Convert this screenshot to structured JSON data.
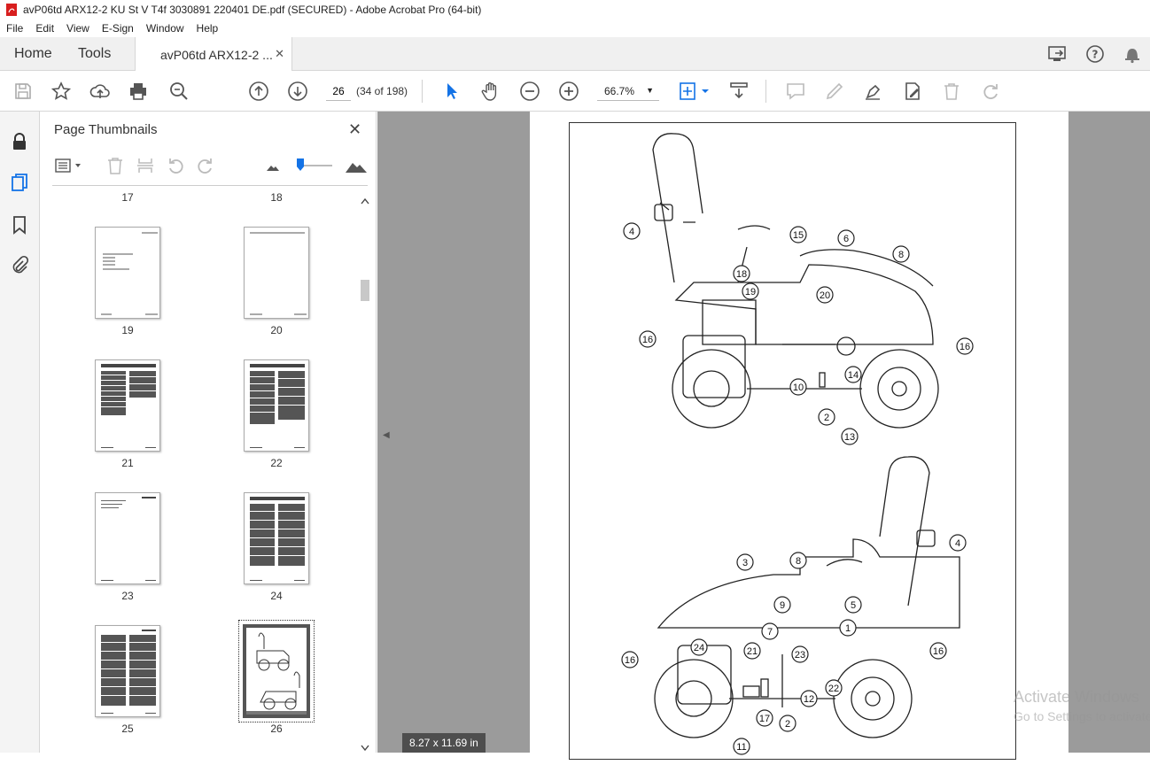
{
  "window": {
    "title": "avP06td ARX12-2 KU St V T4f 3030891 220401 DE.pdf (SECURED) - Adobe Acrobat Pro (64-bit)"
  },
  "menu": [
    "File",
    "Edit",
    "View",
    "E-Sign",
    "Window",
    "Help"
  ],
  "tabs": {
    "home": "Home",
    "tools": "Tools",
    "document": "avP06td ARX12-2 ..."
  },
  "toolbar": {
    "page_current": "26",
    "page_count": "(34 of 198)",
    "zoom": "66.7%"
  },
  "thumbnails": {
    "title": "Page Thumbnails",
    "top_labels": [
      "17",
      "18"
    ],
    "pages": [
      "19",
      "20",
      "21",
      "22",
      "23",
      "24",
      "25",
      "26"
    ],
    "selected_page": "26"
  },
  "document": {
    "page_size": "8.27 x 11.69 in",
    "callouts_top": [
      "4",
      "15",
      "6",
      "8",
      "18",
      "19",
      "20",
      "16",
      "16",
      "14",
      "10",
      "2",
      "13"
    ],
    "callouts_bottom": [
      "4",
      "3",
      "8",
      "9",
      "5",
      "7",
      "1",
      "24",
      "16",
      "16",
      "21",
      "23",
      "22",
      "12",
      "17",
      "2",
      "11"
    ]
  },
  "watermark": {
    "line1": "Activate Windows",
    "line2": "Go to Settings to activate"
  },
  "colors": {
    "accent": "#1473e6",
    "doc_background": "#9b9b9b"
  }
}
